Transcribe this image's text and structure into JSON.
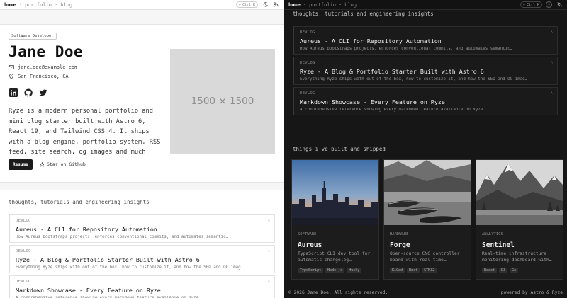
{
  "nav": {
    "home": "home",
    "portfolio": "portfolio",
    "blog": "blog",
    "search_shortcut": "Ctrl K",
    "sep": "·"
  },
  "hero": {
    "badge": "Software Developer",
    "name": "Jane Doe",
    "email": "jane.doe@example.com",
    "location": "San Francisco, CA",
    "bio": "Ryze is a modern personal portfolio and mini blog starter built with Astro 6, React 19, and Tailwind CSS 4. It ships with a blog engine, portfolio system, RSS feed, site search, og images and much more.",
    "resume_label": "Resume",
    "star_label": "Star on Github",
    "placeholder_label": "1500 × 1500"
  },
  "blog": {
    "section_title": "thoughts, tutorials and engineering insights",
    "posts": [
      {
        "tag": "DEVLOG",
        "title": "Aureus - A CLI for Repository Automation",
        "desc": "How Aureus bootstraps projects, enforces conventional commits, and automates semantic…"
      },
      {
        "tag": "DEVLOG",
        "title": "Ryze - A Blog & Portfolio Starter Built with Astro 6",
        "desc": "Everything Ryze ships with out of the box, how to customize it, and how the SEO and OG imag…"
      },
      {
        "tag": "DEVLOG",
        "title": "Markdown Showcase - Every Feature on Ryze",
        "desc": "A comprehensive reference showing every markdown feature available on Ryze"
      }
    ]
  },
  "projects": {
    "section_title": "things i've built and shipped",
    "items": [
      {
        "tag": "SOFTWARE",
        "title": "Aureus",
        "desc": "TypeScript CLI dev tool for automatic changelog…",
        "chips": [
          "TypeScript",
          "Node.js",
          "Husky"
        ]
      },
      {
        "tag": "HARDWARE",
        "title": "Forge",
        "desc": "Open-source CNC controller board with real-time…",
        "chips": [
          "KiCad",
          "Rust",
          "STM32"
        ]
      },
      {
        "tag": "ANALYTICS",
        "title": "Sentinel",
        "desc": "Real-time infrastructure monitoring dashboard with…",
        "chips": [
          "React",
          "D3",
          "Go"
        ]
      }
    ]
  },
  "footer": {
    "copyright": "© 2026 Jane Doe. All rights reserved.",
    "powered": "powered by Astro & Ryze"
  },
  "colors": {
    "dark_bg": "#161616",
    "light_bg": "#f6f6f6",
    "button_dark": "#1b1b1b"
  },
  "icons": [
    "search-icon",
    "moon-icon",
    "rss-icon",
    "mail-icon",
    "location-pin-icon",
    "linkedin-icon",
    "github-icon",
    "twitter-icon",
    "star-icon",
    "chevron-up-icon"
  ]
}
